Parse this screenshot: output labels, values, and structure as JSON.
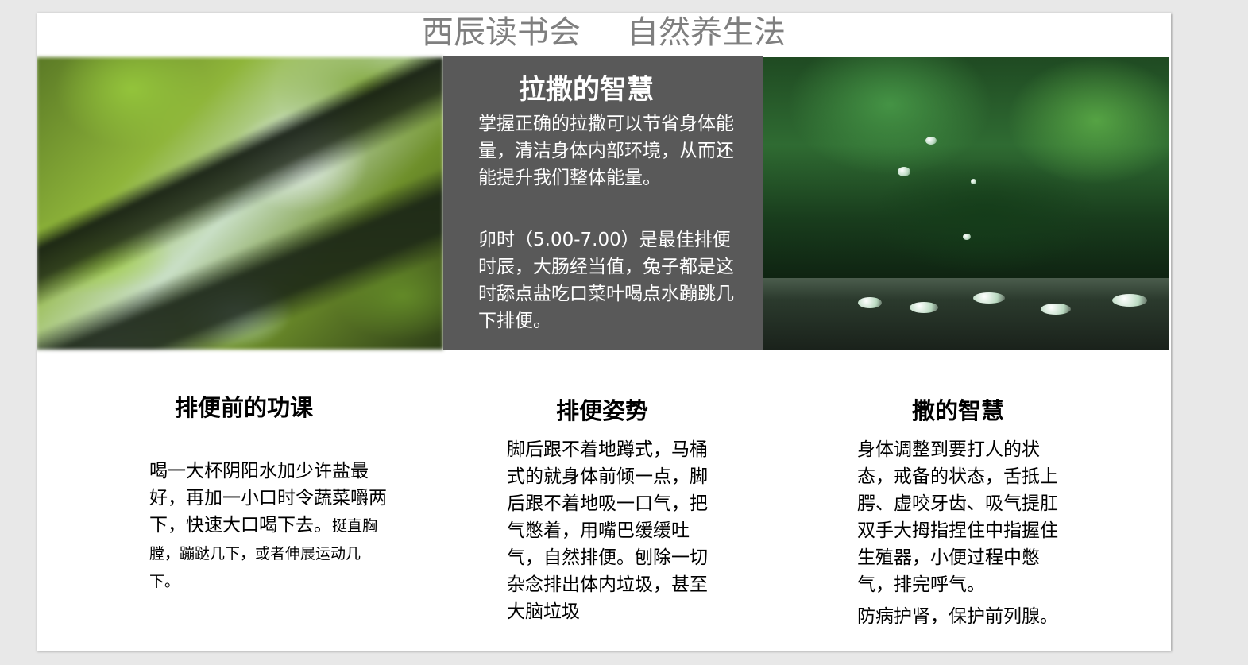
{
  "title": {
    "part1": "西辰读书会",
    "part2": "自然养生法"
  },
  "center_panel": {
    "heading": "拉撒的智慧",
    "paragraph1": "掌握正确的拉撒可以节省身体能量，清洁身体内部环境，从而还能提升我们整体能量。",
    "paragraph2": "卯时（5.00-7.00）是最佳排便时辰，大肠经当值，兔子都是这时舔点盐吃口菜叶喝点水蹦跳几下排便。"
  },
  "columns": [
    {
      "heading": "排便前的功课",
      "body_main": "喝一大杯阴阳水加少许盐最好，再加一小口时令蔬菜嚼两下，快速大口喝下去。",
      "body_small": "挺直胸膛，蹦跶几下，或者伸展运动几下。"
    },
    {
      "heading": "排便姿势",
      "body_main": "脚后跟不着地蹲式，马桶式的就身体前倾一点，脚后跟不着地吸一口气，把气憋着，用嘴巴缓缓吐气，自然排便。刨除一切杂念排出体内垃圾，甚至大脑垃圾"
    },
    {
      "heading": "撒的智慧",
      "body_main": "身体调整到要打人的状态，戒备的状态，舌抵上腭、虚咬牙齿、吸气提肛双手大拇指捏住中指握住生殖器，小便过程中憋气，排完呼气。",
      "body_extra": "防病护肾，保护前列腺。"
    }
  ],
  "images": {
    "left": "blurred-forest-photo",
    "right": "rain-drops-green-photo"
  }
}
